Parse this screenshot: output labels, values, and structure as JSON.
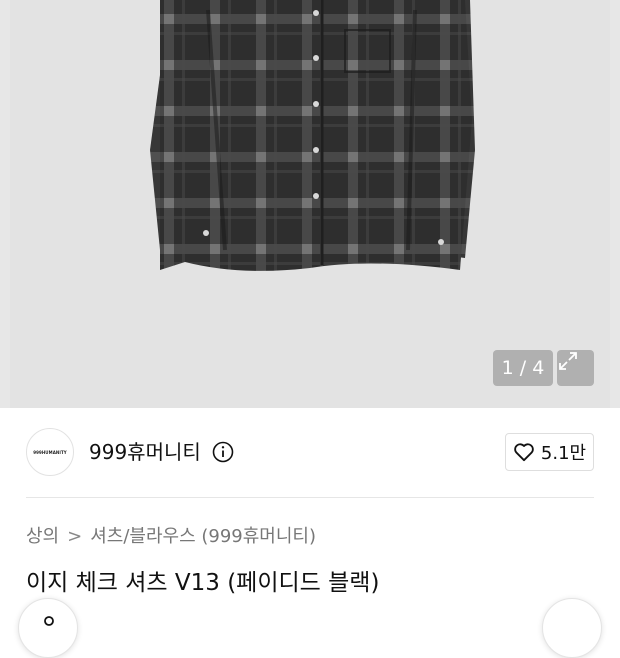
{
  "gallery": {
    "counter": "1 / 4",
    "expand_icon": "expand-icon"
  },
  "brand": {
    "logo_text": "999HUMANITY",
    "name": "999휴머니티",
    "info_icon": "info-icon"
  },
  "like": {
    "icon": "heart-icon",
    "count": "5.1만"
  },
  "breadcrumb": {
    "category": "상의",
    "separator": ">",
    "subcategory": "셔츠/블라우스 (999휴머니티)"
  },
  "product": {
    "title": "이지 체크 셔츠 V13 (페이디드 블랙)"
  },
  "colors": {
    "image_bg": "#e3e3e3",
    "shirt_base": "#2b2b2b",
    "text_primary": "#111111",
    "text_secondary": "#777777"
  }
}
